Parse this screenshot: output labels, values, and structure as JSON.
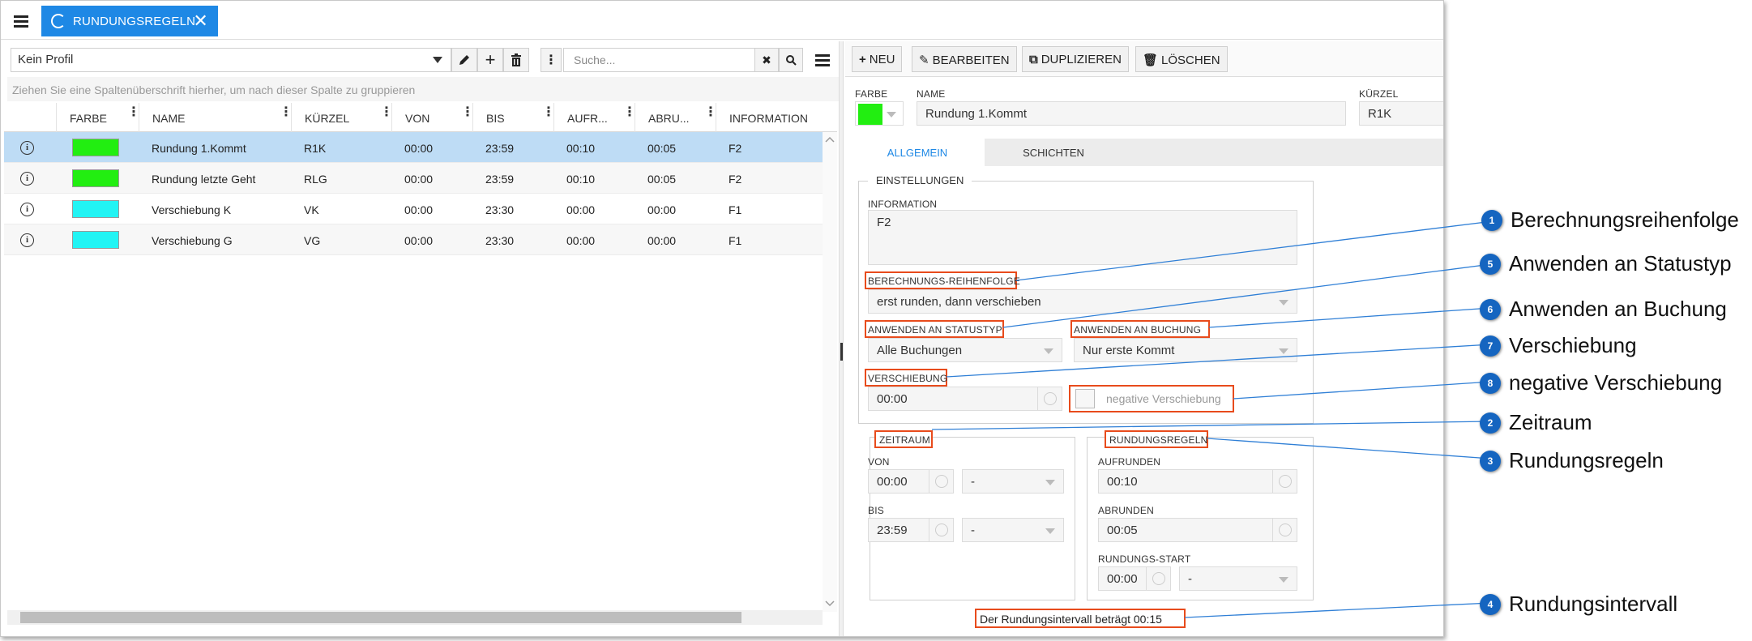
{
  "tab": {
    "title": "RUNDUNGSREGELN"
  },
  "left": {
    "profile": "Kein Profil",
    "search_placeholder": "Suche...",
    "group_hint": "Ziehen Sie eine Spaltenüberschrift hierher, um nach dieser Spalte zu gruppieren",
    "columns": [
      "FARBE",
      "NAME",
      "KÜRZEL",
      "VON",
      "BIS",
      "AUFR...",
      "ABRU...",
      "INFORMATION"
    ],
    "rows": [
      {
        "color": "#22ee11",
        "name": "Rundung 1.Kommt",
        "kuerzel": "R1K",
        "von": "00:00",
        "bis": "23:59",
        "aufr": "00:10",
        "abru": "00:05",
        "info": "F2"
      },
      {
        "color": "#22ee11",
        "name": "Rundung letzte Geht",
        "kuerzel": "RLG",
        "von": "00:00",
        "bis": "23:59",
        "aufr": "00:10",
        "abru": "00:05",
        "info": "F2"
      },
      {
        "color": "#22f4f4",
        "name": "Verschiebung K",
        "kuerzel": "VK",
        "von": "00:00",
        "bis": "23:30",
        "aufr": "00:00",
        "abru": "00:00",
        "info": "F1"
      },
      {
        "color": "#22f4f4",
        "name": "Verschiebung G",
        "kuerzel": "VG",
        "von": "00:00",
        "bis": "23:30",
        "aufr": "00:00",
        "abru": "00:00",
        "info": "F1"
      }
    ]
  },
  "right": {
    "buttons": {
      "new": "NEU",
      "edit": "BEARBEITEN",
      "duplicate": "DUPLIZIEREN",
      "delete": "LÖSCHEN"
    },
    "farbe_label": "FARBE",
    "farbe_color": "#22ee11",
    "name_label": "NAME",
    "name_value": "Rundung 1.Kommt",
    "kuerzel_label": "KÜRZEL",
    "kuerzel_value": "R1K",
    "tabs": [
      "ALLGEMEIN",
      "SCHICHTEN"
    ],
    "einstellungen": "EINSTELLUNGEN",
    "information_label": "INFORMATION",
    "information_value": "F2",
    "berechnung_label": "BERECHNUNGS-REIHENFOLGE",
    "berechnung_value": "erst runden, dann verschieben",
    "statustyp_label": "ANWENDEN AN STATUSTYP",
    "statustyp_value": "Alle Buchungen",
    "buchung_label": "ANWENDEN AN BUCHUNG",
    "buchung_value": "Nur erste Kommt",
    "verschiebung_label": "VERSCHIEBUNG",
    "verschiebung_value": "00:00",
    "negative_label": "negative Verschiebung",
    "zeitraum_label": "ZEITRAUM",
    "von_label": "VON",
    "von_value": "00:00",
    "von_select": "-",
    "bis_label": "BIS",
    "bis_value": "23:59",
    "bis_select": "-",
    "rundungsregeln_label": "RUNDUNGSREGELN",
    "aufrunden_label": "AUFRUNDEN",
    "aufrunden_value": "00:10",
    "abrunden_label": "ABRUNDEN",
    "abrunden_value": "00:05",
    "start_label": "RUNDUNGS-START",
    "start_value": "00:00",
    "start_select": "-",
    "interval_text": "Der Rundungsintervall beträgt 00:15"
  },
  "callouts": [
    {
      "num": "1",
      "text": "Berechnungsreihenfolge"
    },
    {
      "num": "5",
      "text": "Anwenden an Statustyp"
    },
    {
      "num": "6",
      "text": "Anwenden an Buchung"
    },
    {
      "num": "7",
      "text": "Verschiebung"
    },
    {
      "num": "8",
      "text": "negative Verschiebung"
    },
    {
      "num": "2",
      "text": "Zeitraum"
    },
    {
      "num": "3",
      "text": "Rundungsregeln"
    },
    {
      "num": "4",
      "text": "Rundungsintervall"
    }
  ]
}
